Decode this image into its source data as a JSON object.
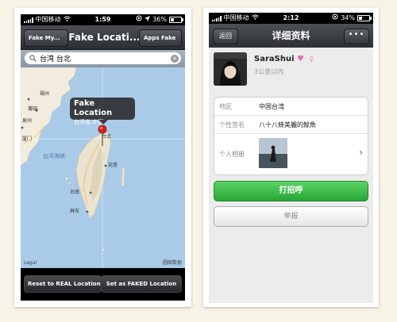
{
  "left_phone": {
    "status": {
      "carrier": "中国移动",
      "time": "1:59",
      "battery": "36%",
      "battery_level": 0.36
    },
    "nav": {
      "left_button": "Fake My...",
      "title": "Fake Locati...",
      "right_button": "Apps Fake"
    },
    "search": {
      "value": "台湾 台北"
    },
    "map": {
      "callout_title": "Fake Location",
      "callout_subtitle": "台湾省,中国",
      "labels": {
        "fuzhou": "福州",
        "sea": "台湾海峡",
        "hualien": "花莲",
        "pingtung": "屏东",
        "taipei": "台北",
        "putian": "莆田",
        "quanzhou": "泉州",
        "xiamen": "厦门",
        "tainan": "台南"
      },
      "legal": "Legal",
      "credit": "圆图数据"
    },
    "bottom": {
      "reset_label": "Reset to REAL Location",
      "set_label": "Set as FAKED Location"
    }
  },
  "right_phone": {
    "status": {
      "carrier": "中国移动",
      "time": "2:12",
      "battery": "34%",
      "battery_level": 0.34
    },
    "nav": {
      "back": "返回",
      "title": "详细资料",
      "more": "•••"
    },
    "profile": {
      "name": "SaraShui",
      "distance": "3公里以内"
    },
    "info": {
      "region_label": "地区",
      "region_value": "中国台湾",
      "signature_label": "个性签名",
      "signature_value": "八十八條美麗的鯨魚",
      "album_label": "个人相册"
    },
    "greet_label": "打招呼",
    "report_label": "举报"
  },
  "colors": {
    "greet": "#2bab3a",
    "map_water": "#a9cbe8",
    "map_land": "#f1ecdd"
  }
}
